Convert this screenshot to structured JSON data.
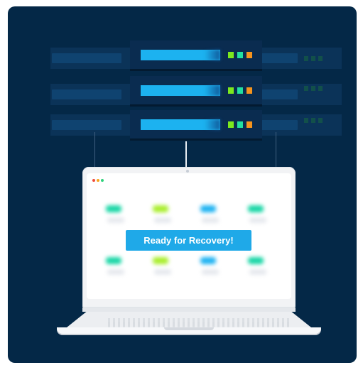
{
  "screen": {
    "status_button_label": "Ready for Recovery!"
  },
  "colors": {
    "background_panel": "#042847",
    "progress_bar": "#1cb2f0",
    "led_green_1": "#7ce81e",
    "led_green_2": "#22e0a0",
    "led_orange": "#f6941d",
    "button": "#1fa9e8",
    "window_dot_red": "#f04c3a",
    "window_dot_orange": "#f7a51b",
    "window_dot_green": "#2fd27c"
  },
  "icons": {
    "rack_status_lights": "three-square-led-icon",
    "window_controls": "three-dot-window-icon"
  }
}
